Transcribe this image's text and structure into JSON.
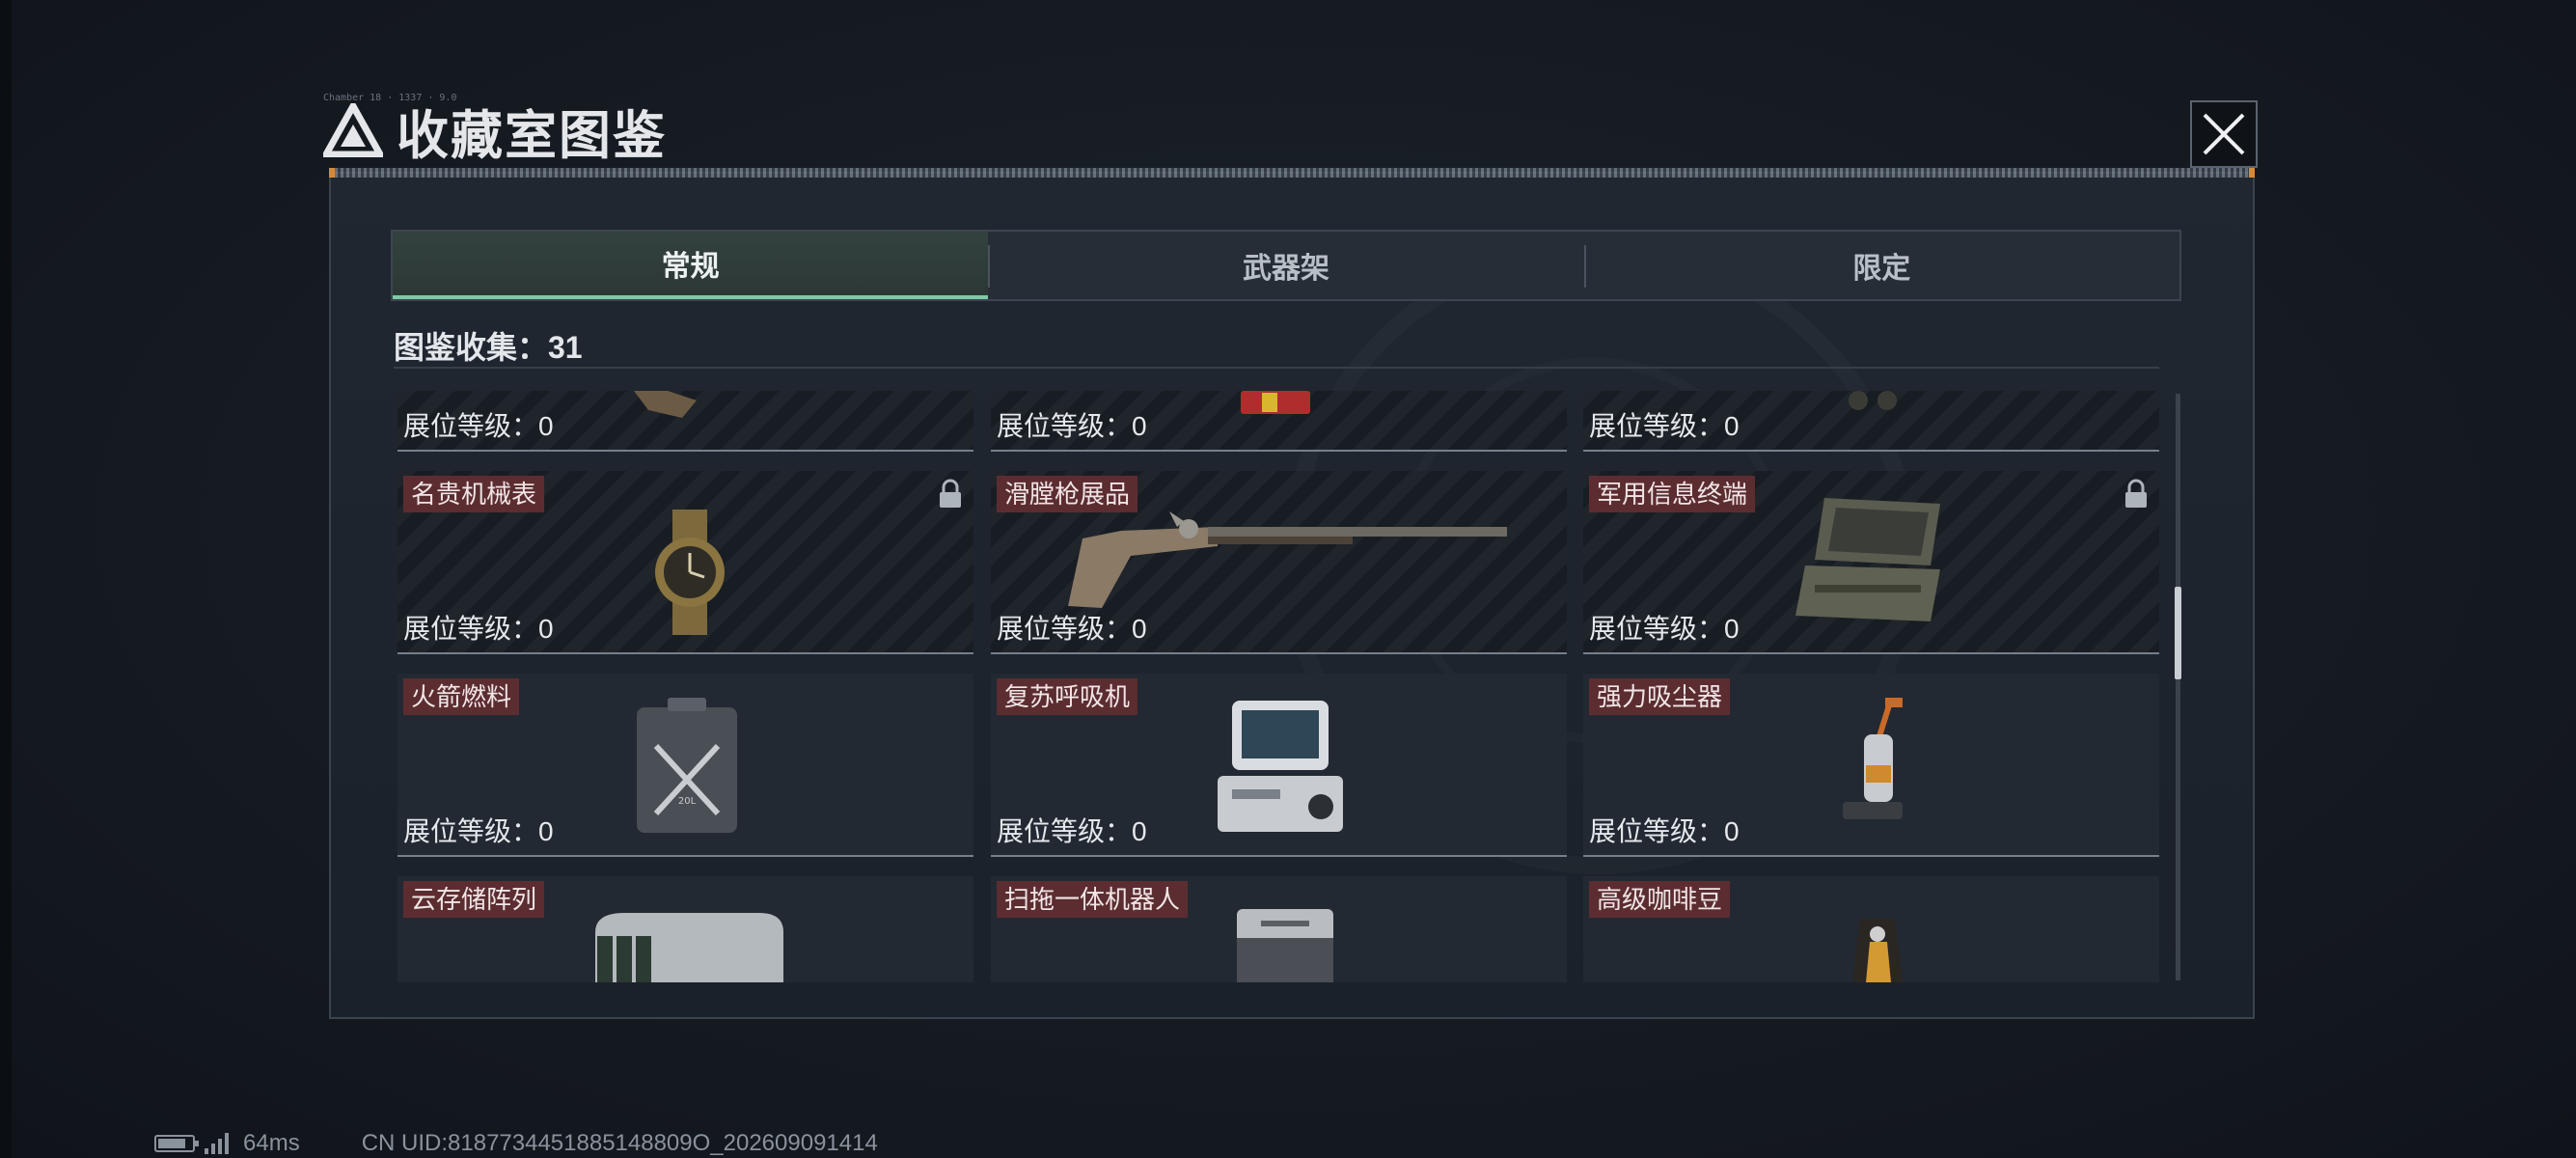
{
  "dialog": {
    "title": "收藏室图鉴",
    "title_tiny": "Chamber 18 · 1337 · 9.0"
  },
  "tabs": [
    {
      "label": "常规",
      "active": true
    },
    {
      "label": "武器架",
      "active": false
    },
    {
      "label": "限定",
      "active": false
    }
  ],
  "collection": {
    "label": "图鉴收集：31"
  },
  "level_label": "展位等级：0",
  "rows": [
    {
      "partial": true,
      "items": [
        {
          "name": "",
          "level": "展位等级：0",
          "art": "partial-item-icon",
          "locked": false,
          "striped": true
        },
        {
          "name": "",
          "level": "展位等级：0",
          "art": "partial-item-icon",
          "locked": false,
          "striped": true
        },
        {
          "name": "",
          "level": "展位等级：0",
          "art": "partial-item-icon",
          "locked": false,
          "striped": true
        }
      ]
    },
    {
      "items": [
        {
          "name": "名贵机械表",
          "level": "展位等级：0",
          "art": "wristwatch-icon",
          "locked": true,
          "striped": true
        },
        {
          "name": "滑膛枪展品",
          "level": "展位等级：0",
          "art": "musket-icon",
          "locked": false,
          "striped": true
        },
        {
          "name": "军用信息终端",
          "level": "展位等级：0",
          "art": "rugged-terminal-icon",
          "locked": true,
          "striped": true
        }
      ]
    },
    {
      "items": [
        {
          "name": "火箭燃料",
          "level": "展位等级：0",
          "art": "fuel-can-icon",
          "locked": false,
          "striped": false
        },
        {
          "name": "复苏呼吸机",
          "level": "展位等级：0",
          "art": "ventilator-icon",
          "locked": false,
          "striped": false
        },
        {
          "name": "强力吸尘器",
          "level": "展位等级：0",
          "art": "vacuum-cleaner-icon",
          "locked": false,
          "striped": false
        }
      ]
    },
    {
      "partial": true,
      "items": [
        {
          "name": "云存储阵列",
          "level": "",
          "art": "storage-array-icon",
          "locked": false,
          "striped": false
        },
        {
          "name": "扫拖一体机器人",
          "level": "",
          "art": "robot-station-icon",
          "locked": false,
          "striped": false
        },
        {
          "name": "高级咖啡豆",
          "level": "",
          "art": "coffee-bag-icon",
          "locked": false,
          "striped": false
        }
      ]
    }
  ],
  "status_bar": {
    "ping": "64ms",
    "uid": "CN UID:8187734451885148809O_202609091414"
  },
  "colors": {
    "tab_active_underline": "#7fc9a6",
    "name_tag_bg": "#5b2d31",
    "accent_orange": "#d48a3a"
  }
}
